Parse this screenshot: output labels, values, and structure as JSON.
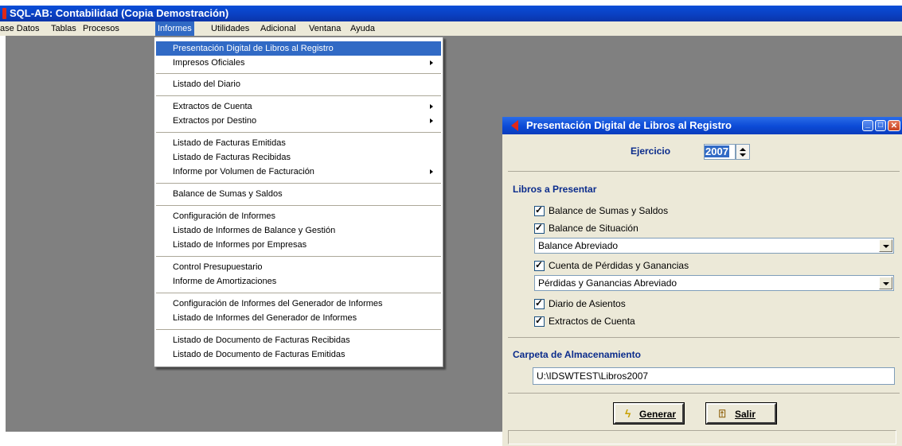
{
  "window": {
    "title": "SQL-AB: Contabilidad (Copia Demostración)"
  },
  "menubar": {
    "items": [
      {
        "label": "ase Datos"
      },
      {
        "label": "Tablas"
      },
      {
        "label": "Procesos"
      },
      {
        "label": "Informes"
      },
      {
        "label": "Utilidades"
      },
      {
        "label": "Adicional"
      },
      {
        "label": "Ventana"
      },
      {
        "label": "Ayuda"
      }
    ]
  },
  "informes_menu": {
    "items": [
      {
        "label": "Presentación Digital de Libros al Registro"
      },
      {
        "label": "Impresos Oficiales"
      },
      {
        "label": "Listado del Diario"
      },
      {
        "label": "Extractos de Cuenta"
      },
      {
        "label": "Extractos por Destino"
      },
      {
        "label": "Listado de Facturas Emitidas"
      },
      {
        "label": "Listado de Facturas Recibidas"
      },
      {
        "label": "Informe por Volumen de Facturación"
      },
      {
        "label": "Balance de Sumas y Saldos"
      },
      {
        "label": "Configuración de Informes"
      },
      {
        "label": "Listado de Informes de Balance y Gestión"
      },
      {
        "label": "Listado de Informes por Empresas"
      },
      {
        "label": "Control Presupuestario"
      },
      {
        "label": "Informe de Amortizaciones"
      },
      {
        "label": "Configuración de Informes del Generador de Informes"
      },
      {
        "label": "Listado de Informes del Generador de Informes"
      },
      {
        "label": "Listado de Documento de Facturas Recibidas"
      },
      {
        "label": "Listado de Documento de Facturas Emitidas"
      }
    ]
  },
  "dialog": {
    "title": "Presentación Digital de Libros al Registro",
    "ejercicio_label": "Ejercicio",
    "ejercicio_value": "2007",
    "libros_heading": "Libros a Presentar",
    "checks": {
      "balance_sumas": "Balance de Sumas y Saldos",
      "balance_situacion": "Balance de Situación",
      "cuenta_pyg": "Cuenta de Pérdidas y Ganancias",
      "diario": "Diario de Asientos",
      "extractos": "Extractos de Cuenta"
    },
    "check_mark": "✓",
    "balance_situacion_option": "Balance Abreviado",
    "pyg_option": "Pérdidas y Ganancias Abreviado",
    "carpeta_heading": "Carpeta de Almacenamiento",
    "carpeta_value": "U:\\IDSWTEST\\Libros2007",
    "generar_label": "Generar",
    "salir_label": "Salir",
    "generar_icon": "lightning-icon",
    "salir_icon": "door-exit-icon"
  },
  "colors": {
    "titlebar": "#0a4ed8",
    "menu_highlight": "#316ac5",
    "desktop": "#808080",
    "dialog_bg": "#ece9d8",
    "heading_blue": "#0b2c8c"
  }
}
